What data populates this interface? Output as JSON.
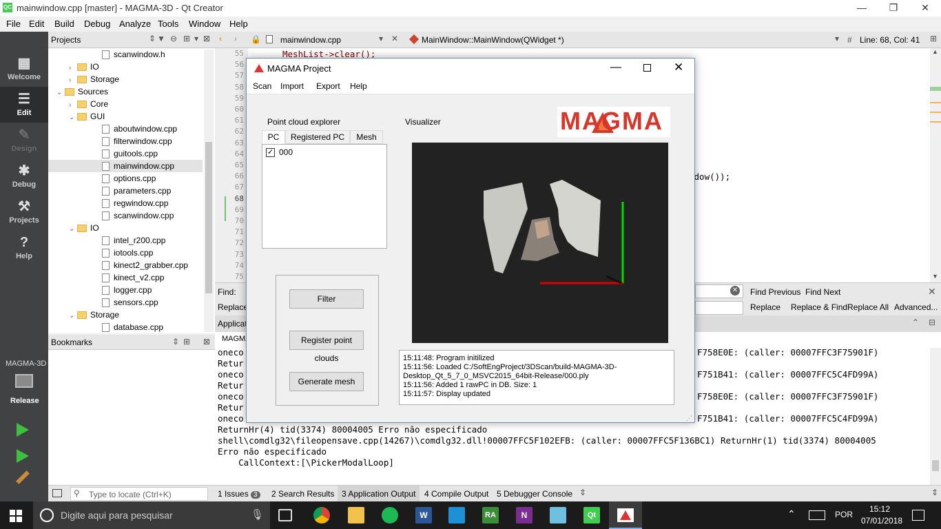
{
  "window": {
    "title": "mainwindow.cpp [master] - MAGMA-3D - Qt Creator",
    "min": "—",
    "max": "❐",
    "close": "✕"
  },
  "menu": [
    "File",
    "Edit",
    "Build",
    "Debug",
    "Analyze",
    "Tools",
    "Window",
    "Help"
  ],
  "modes": [
    "Welcome",
    "Edit",
    "Design",
    "Debug",
    "Projects",
    "Help"
  ],
  "kit": {
    "project": "MAGMA-3D",
    "config": "Release"
  },
  "projects": {
    "header": "Projects",
    "tree": [
      {
        "label": "scanwindow.h",
        "kind": "file",
        "depth": 3
      },
      {
        "label": "IO",
        "kind": "folder",
        "depth": 2,
        "arrow": "›"
      },
      {
        "label": "Storage",
        "kind": "folder",
        "depth": 2,
        "arrow": "›"
      },
      {
        "label": "Sources",
        "kind": "folder",
        "depth": 1,
        "arrow": "⌄"
      },
      {
        "label": "Core",
        "kind": "folder",
        "depth": 2,
        "arrow": "›"
      },
      {
        "label": "GUI",
        "kind": "folder",
        "depth": 2,
        "arrow": "⌄"
      },
      {
        "label": "aboutwindow.cpp",
        "kind": "file",
        "depth": 3
      },
      {
        "label": "filterwindow.cpp",
        "kind": "file",
        "depth": 3
      },
      {
        "label": "guitools.cpp",
        "kind": "file",
        "depth": 3
      },
      {
        "label": "mainwindow.cpp",
        "kind": "file",
        "depth": 3,
        "selected": true
      },
      {
        "label": "options.cpp",
        "kind": "file",
        "depth": 3
      },
      {
        "label": "parameters.cpp",
        "kind": "file",
        "depth": 3
      },
      {
        "label": "regwindow.cpp",
        "kind": "file",
        "depth": 3
      },
      {
        "label": "scanwindow.cpp",
        "kind": "file",
        "depth": 3
      },
      {
        "label": "IO",
        "kind": "folder",
        "depth": 2,
        "arrow": "⌄"
      },
      {
        "label": "intel_r200.cpp",
        "kind": "file",
        "depth": 3
      },
      {
        "label": "iotools.cpp",
        "kind": "file",
        "depth": 3
      },
      {
        "label": "kinect2_grabber.cpp",
        "kind": "file",
        "depth": 3
      },
      {
        "label": "kinect_v2.cpp",
        "kind": "file",
        "depth": 3
      },
      {
        "label": "logger.cpp",
        "kind": "file",
        "depth": 3
      },
      {
        "label": "sensors.cpp",
        "kind": "file",
        "depth": 3
      },
      {
        "label": "Storage",
        "kind": "folder",
        "depth": 2,
        "arrow": "⌄"
      },
      {
        "label": "database.cpp",
        "kind": "file",
        "depth": 3
      }
    ]
  },
  "bookmarks": {
    "header": "Bookmarks"
  },
  "editor": {
    "file_tab": "mainwindow.cpp",
    "symbol": "MainWindow::MainWindow(QWidget *)",
    "position": "Line: 68, Col: 41",
    "line_numbers": [
      "55",
      "56",
      "57",
      "58",
      "59",
      "60",
      "61",
      "62",
      "63",
      "64",
      "65",
      "66",
      "67",
      "68",
      "69",
      "70",
      "71",
      "72",
      "73",
      "74",
      "75"
    ],
    "code_line": "MeshList->clear();",
    "code_tail": "adow());"
  },
  "find": {
    "find_label": "Find:",
    "replace_label": "Replace",
    "find_prev": "Find Previous",
    "find_next": "Find Next",
    "replace": "Replace",
    "replace_find": "Replace & Find",
    "replace_all": "Replace All",
    "advanced": "Advanced..."
  },
  "output": {
    "header": "Applicati",
    "tab": "MAGMA",
    "left_lines": [
      "oneco",
      "Retur",
      "oneco",
      "Retur",
      "oneco",
      "Retur",
      "oneco"
    ],
    "right_lines": [
      "F758E0E: (caller: 00007FFC3F75901F)",
      "F751B41: (caller: 00007FFC5C4FD99A)",
      "F758E0E: (caller: 00007FFC3F75901F)",
      "F751B41: (caller: 00007FFC5C4FD99A)"
    ],
    "full_lines": [
      "ReturnHr(4) tid(3374) 80004005 Erro não especificado",
      "shell\\comdlg32\\fileopensave.cpp(14267)\\comdlg32.dll!00007FFC5F102EFB: (caller: 00007FFC5F136BC1) ReturnHr(1) tid(3374) 80004005",
      "Erro não especificado",
      "    CallContext:[\\PickerModalLoop]"
    ]
  },
  "statusbar": {
    "locate_placeholder": "Type to locate (Ctrl+K)",
    "tabs": [
      "1 Issues",
      "2 Search Results",
      "3 Application Output",
      "4 Compile Output",
      "5 Debugger Console"
    ],
    "issues_count": "3"
  },
  "dialog": {
    "title": "MAGMA Project",
    "menu": [
      "Scan",
      "Import",
      "Export",
      "Help"
    ],
    "explorer_label": "Point cloud explorer",
    "visualizer_label": "Visualizer",
    "logo": "MAGMA",
    "tabs": [
      "PC",
      "Registered PC",
      "Mesh"
    ],
    "pc_item": "000",
    "buttons": {
      "filter": "Filter",
      "register": "Register point clouds",
      "mesh": "Generate mesh"
    },
    "log": [
      "15:11:48: Program initilized",
      "15:11:56: Loaded C:/SoftEngProject/3DScan/build-MAGMA-3D-",
      "Desktop_Qt_5_7_0_MSVC2015_64bit-Release/000.ply",
      "15:11:56: Added 1 rawPC in DB. Size: 1",
      "15:11:57: Display updated"
    ]
  },
  "taskbar": {
    "search_placeholder": "Digite aqui para pesquisar",
    "lang": "POR",
    "time": "15:12",
    "date": "07/01/2018"
  }
}
